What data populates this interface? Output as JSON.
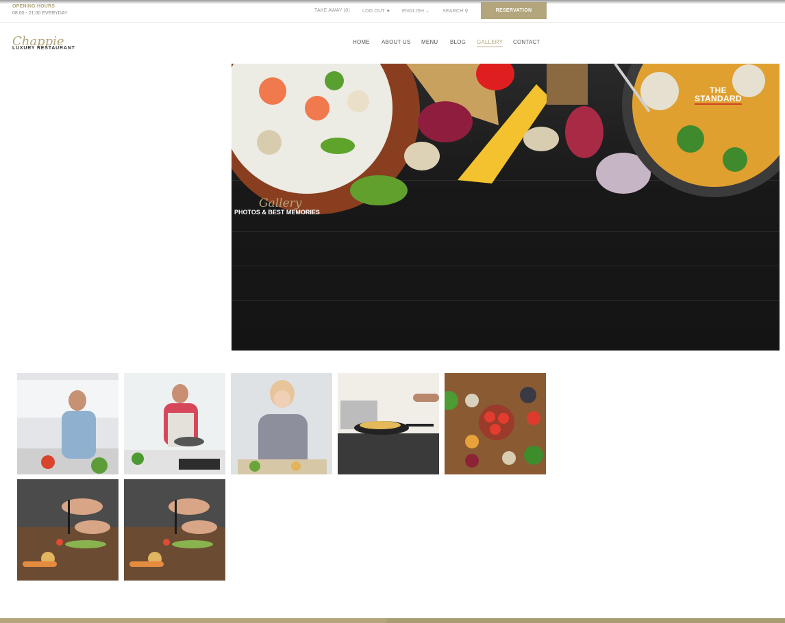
{
  "topbar": {
    "hours_label": "OPENING HOURS",
    "hours_value": "08:00 - 21:00 EVERYDAY",
    "take_away": "TAKE AWAY (0)",
    "logout": "LOG OUT",
    "language": "ENGLISH",
    "search": "SEARCH",
    "reservation": "RESERVATION"
  },
  "logo": {
    "script": "Chappie",
    "sub": "LUXURY RESTAURANT"
  },
  "nav": {
    "items": [
      {
        "label": "HOME"
      },
      {
        "label": "ABOUT US"
      },
      {
        "label": "MENU"
      },
      {
        "label": "BLOG"
      },
      {
        "label": "GALLERY"
      },
      {
        "label": "CONTACT"
      }
    ],
    "active": "GALLERY"
  },
  "hero": {
    "title": "Gallery",
    "subtitle": "PHOTOS & BEST MEMORIES",
    "badge_line1": "THE",
    "badge_line2": "STANDARD"
  },
  "gallery": {
    "items": [
      {
        "subject": "man-cooking"
      },
      {
        "subject": "woman-cooking"
      },
      {
        "subject": "girl-cutting"
      },
      {
        "subject": "pan-on-stove"
      },
      {
        "subject": "tomatoes-spices"
      },
      {
        "subject": "chopping-vegetables"
      },
      {
        "subject": "chopping-vegetables"
      }
    ]
  },
  "colors": {
    "accent": "#b3a57c",
    "text": "#555555",
    "muted": "#999999",
    "dark": "#181818"
  }
}
